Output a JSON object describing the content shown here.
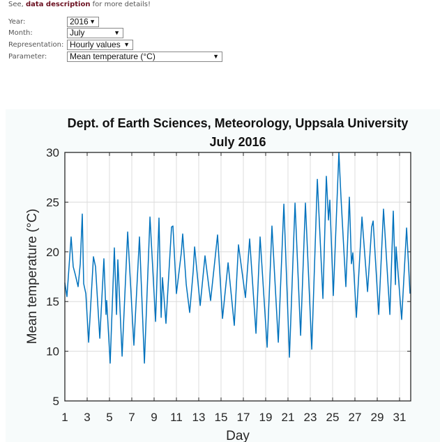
{
  "intro": {
    "prefix": "See, ",
    "link": "data description",
    "suffix": " for more details!"
  },
  "form": {
    "year": {
      "label": "Year:",
      "value": "2016"
    },
    "month": {
      "label": "Month:",
      "value": "July"
    },
    "representation": {
      "label": "Representation:",
      "value": "Hourly values"
    },
    "parameter": {
      "label": "Parameter:",
      "value": "Mean temperature (°C)"
    }
  },
  "chart_data": {
    "type": "line",
    "title": "Dept. of Earth Sciences, Meteorology, Uppsala University",
    "subtitle": "July 2016",
    "xlabel": "Day",
    "ylabel": "Mean temperature (°C)",
    "xlim": [
      1,
      32
    ],
    "ylim": [
      5,
      30
    ],
    "xticks": [
      "1",
      "3",
      "5",
      "7",
      "9",
      "11",
      "13",
      "15",
      "17",
      "19",
      "21",
      "23",
      "25",
      "27",
      "29",
      "31"
    ],
    "yticks": [
      "5",
      "10",
      "15",
      "20",
      "25",
      "30"
    ],
    "grid": true,
    "line_color": "#0072bd",
    "series": [
      {
        "x": [
          1.0,
          1.19,
          1.56,
          1.75,
          1.94,
          2.19,
          2.38,
          2.56,
          2.69,
          2.88,
          3.13,
          3.56,
          3.75,
          4.13,
          4.5,
          4.69,
          4.75,
          5.06,
          5.44,
          5.63,
          5.75,
          6.13,
          6.63,
          7.19,
          7.69,
          8.13,
          8.63,
          9.13,
          9.44,
          9.63,
          9.75,
          10.06,
          10.56,
          10.69,
          11.0,
          11.44,
          11.56,
          11.88,
          12.19,
          12.5,
          12.63,
          13.13,
          13.56,
          14.06,
          14.69,
          15.13,
          15.63,
          16.19,
          16.56,
          17.19,
          17.56,
          18.13,
          18.5,
          19.13,
          19.56,
          20.13,
          20.63,
          21.13,
          21.63,
          22.13,
          22.56,
          23.13,
          23.63,
          24.13,
          24.44,
          24.63,
          24.75,
          25.06,
          25.56,
          25.75,
          26.19,
          26.5,
          26.69,
          26.81,
          27.13,
          27.63,
          28.13,
          28.5,
          28.63,
          29.13,
          29.56,
          30.13,
          30.44,
          30.63,
          30.69,
          31.19,
          31.63,
          31.94
        ],
        "y": [
          16.9,
          15.5,
          21.5,
          18.5,
          17.7,
          16.5,
          18.8,
          23.8,
          16.8,
          15.8,
          10.9,
          19.5,
          18.5,
          11.3,
          19.3,
          13.7,
          15.1,
          8.8,
          20.4,
          13.7,
          19.2,
          9.5,
          22.0,
          10.6,
          21.5,
          8.8,
          23.5,
          13.0,
          23.4,
          13.4,
          17.4,
          12.8,
          22.5,
          22.6,
          15.8,
          19.9,
          21.8,
          16.7,
          13.9,
          18.0,
          20.5,
          14.6,
          19.6,
          15.1,
          21.7,
          13.3,
          18.9,
          12.6,
          20.7,
          15.4,
          21.3,
          11.8,
          21.5,
          10.4,
          22.6,
          10.9,
          24.8,
          9.4,
          24.9,
          11.6,
          24.9,
          10.2,
          27.3,
          15.3,
          27.6,
          23.2,
          25.2,
          15.6,
          30.0,
          25.5,
          16.5,
          25.5,
          18.8,
          19.9,
          13.4,
          23.5,
          16.0,
          22.5,
          23.1,
          13.7,
          24.3,
          13.7,
          24.1,
          16.7,
          20.5,
          13.2,
          22.4,
          15.8
        ]
      }
    ]
  }
}
